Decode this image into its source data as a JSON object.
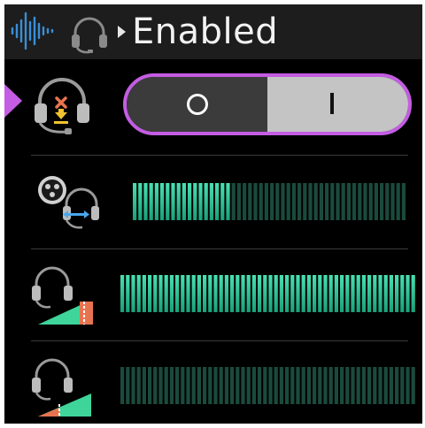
{
  "header": {
    "title": "Enabled",
    "icons": [
      "audio-wave-icon",
      "headset-icon",
      "caret-right-icon"
    ],
    "colors": {
      "wave": "#3a8fd8",
      "headset": "#8a8a8a"
    }
  },
  "rows": [
    {
      "name": "sidetone-toggle",
      "icon": "headset-mic-mute-icon",
      "selected": true,
      "toggle": {
        "off_symbol": "O",
        "on_symbol": "I",
        "state": "on"
      }
    },
    {
      "name": "mic-level",
      "icon": "mic-to-headset-icon",
      "meter_fill": 0.35
    },
    {
      "name": "headset-volume",
      "icon": "headset-volume-high-icon",
      "meter_fill": 1.0
    },
    {
      "name": "mic-monitor-volume",
      "icon": "headset-volume-low-icon",
      "meter_fill": 0.0
    }
  ],
  "colors": {
    "accent": "#c45de3",
    "meter_active_top": "#49e0b0",
    "meter_active_bottom": "#1aa07a",
    "meter_inactive": "#1b4a3c",
    "volume_wedge": "#3fd49a",
    "volume_wedge_low": "#e8744f"
  }
}
